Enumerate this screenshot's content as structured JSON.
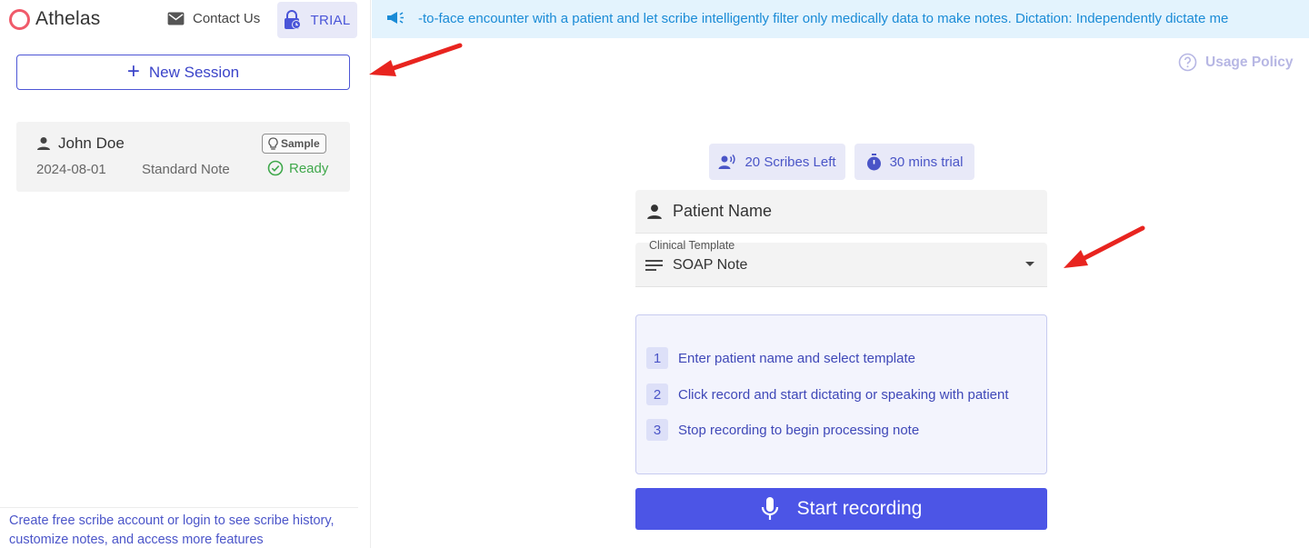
{
  "brand": {
    "name": "Athelas",
    "color": "#f05a6a"
  },
  "header": {
    "contact_label": "Contact Us",
    "trial_label": "TRIAL"
  },
  "sidebar": {
    "new_session_label": "New Session",
    "sessions": [
      {
        "name": "John Doe",
        "badge": "Sample",
        "date": "2024-08-01",
        "note_type": "Standard Note",
        "status": "Ready"
      }
    ],
    "footer_text_line1": "Create free scribe account or login to see scribe history,",
    "footer_text_line2": "customize notes, and access more features"
  },
  "banner": {
    "text": "-to-face encounter with a patient and let scribe intelligently filter only medically data to make notes.    Dictation: Independently dictate me"
  },
  "usage_policy_label": "Usage Policy",
  "chips": {
    "scribes_left": "20 Scribes Left",
    "trial_time": "30 mins trial"
  },
  "form": {
    "patient_name_placeholder": "Patient Name",
    "template_label": "Clinical Template",
    "template_value": "SOAP Note"
  },
  "steps": [
    {
      "num": "1",
      "text": "Enter patient name and select template"
    },
    {
      "num": "2",
      "text": "Click record and start dictating or speaking with patient"
    },
    {
      "num": "3",
      "text": "Stop recording to begin processing note"
    }
  ],
  "record_button_label": "Start recording",
  "colors": {
    "accent": "#4c55e6",
    "ready": "#3fa84b",
    "banner_text": "#1a8bd6",
    "annotation": "#e8241f"
  }
}
